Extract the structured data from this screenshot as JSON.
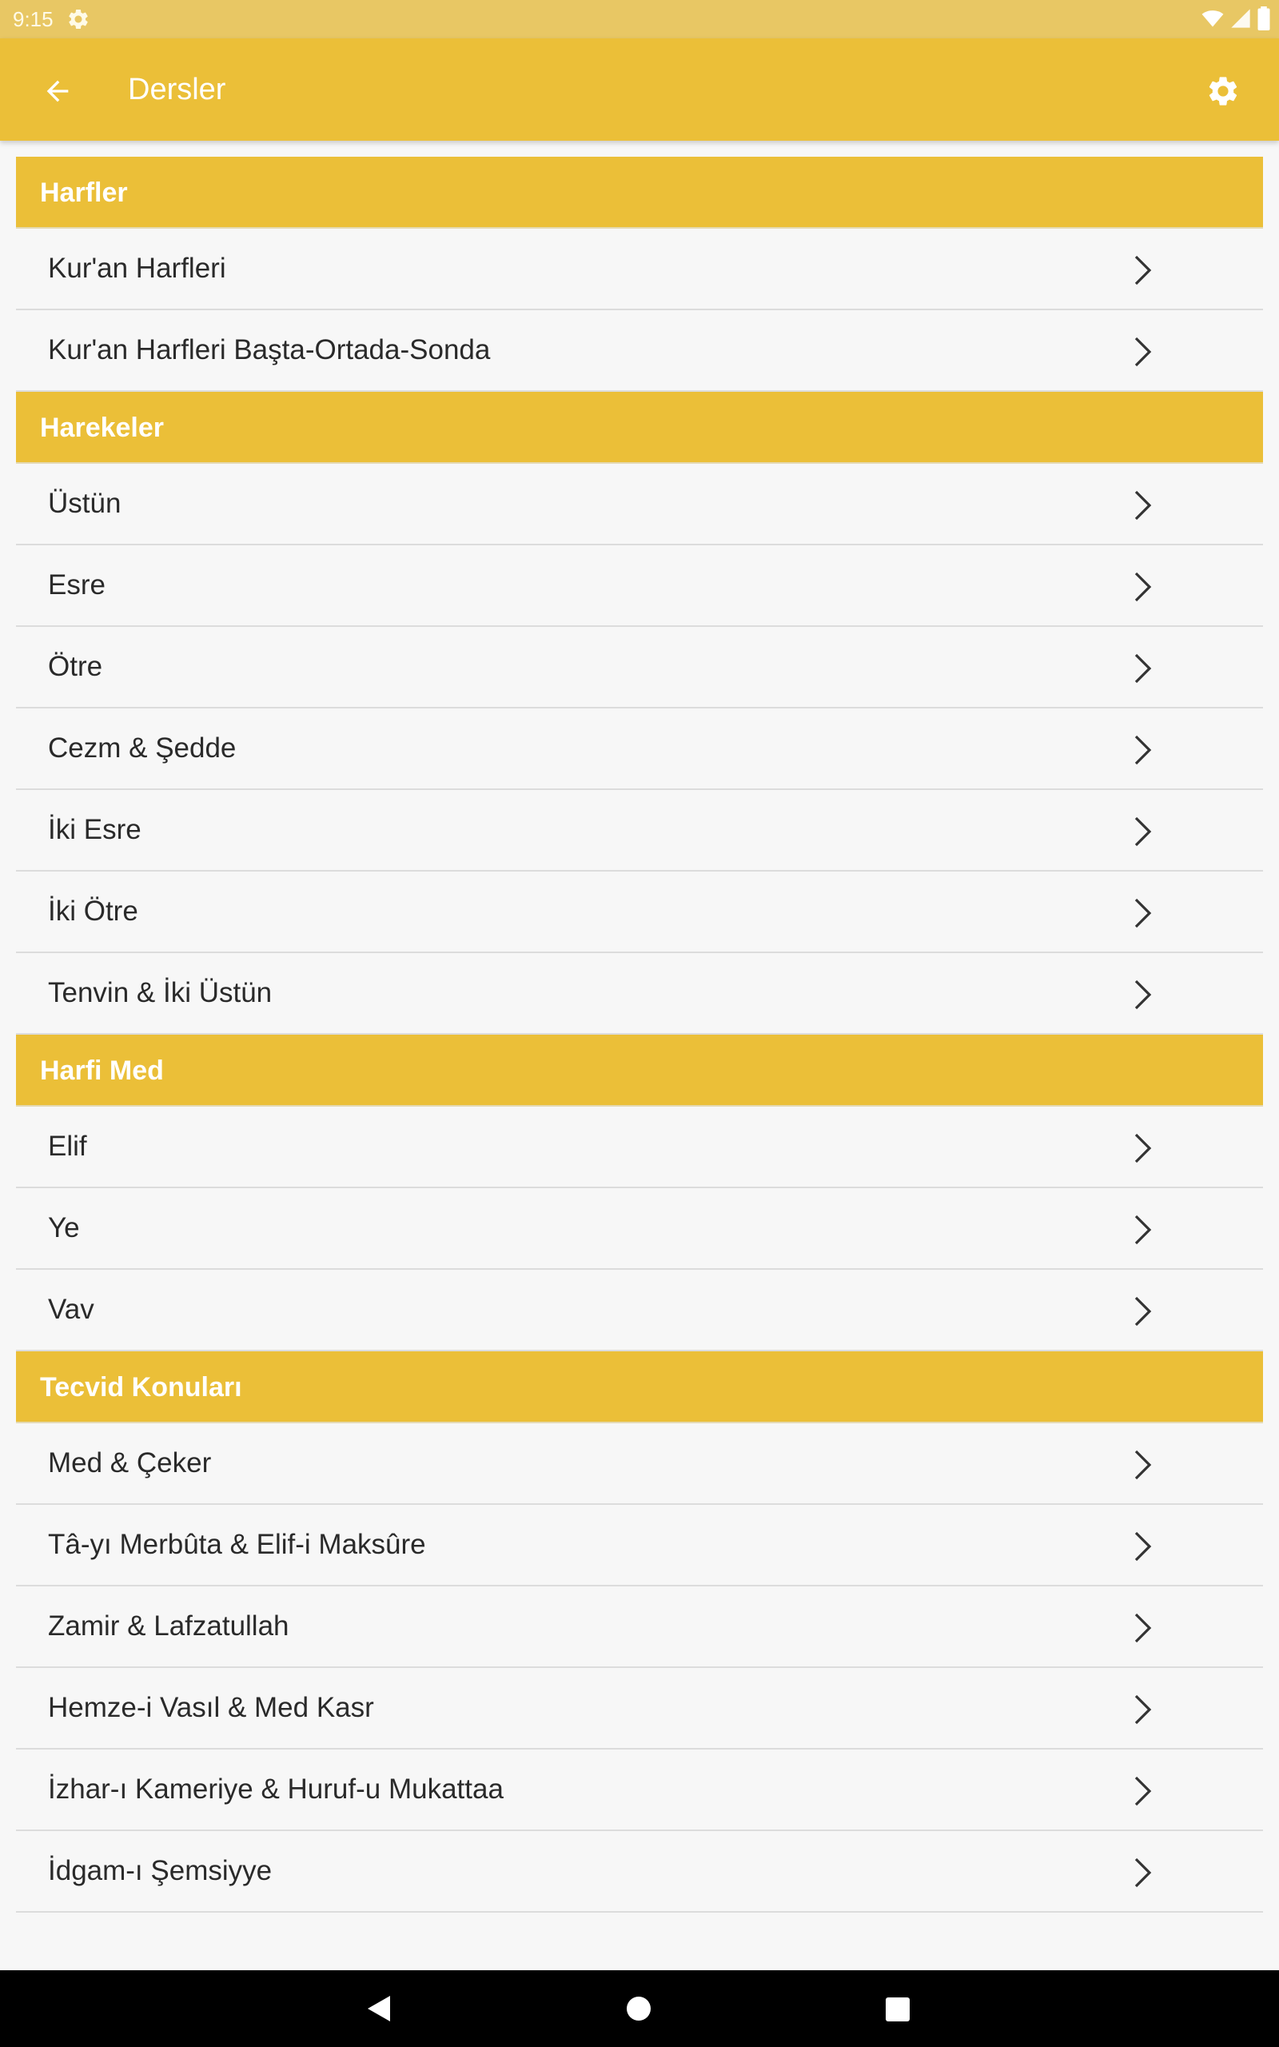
{
  "status_bar": {
    "time": "9:15",
    "icons": [
      "settings-icon",
      "wifi-icon",
      "cell-signal-icon",
      "battery-icon"
    ]
  },
  "app_bar": {
    "title": "Dersler",
    "back_icon": "arrow-left-icon",
    "settings_icon": "gear-icon",
    "color": "#ebbf38"
  },
  "sections": [
    {
      "header": "Harfler",
      "items": [
        "Kur'an Harfleri",
        "Kur'an Harfleri Başta-Ortada-Sonda"
      ]
    },
    {
      "header": "Harekeler",
      "items": [
        "Üstün",
        "Esre",
        "Ötre",
        "Cezm & Şedde",
        "İki Esre",
        "İki Ötre",
        "Tenvin & İki Üstün"
      ]
    },
    {
      "header": "Harfi Med",
      "items": [
        "Elif",
        "Ye",
        "Vav"
      ]
    },
    {
      "header": "Tecvid Konuları",
      "items": [
        "Med & Çeker",
        "Tâ-yı Merbûta & Elif-i Maksûre",
        "Zamir & Lafzatullah",
        "Hemze-i Vasıl & Med Kasr",
        "İzhar-ı Kameriye & Huruf-u Mukattaa",
        "İdgam-ı Şemsiyye"
      ]
    }
  ],
  "nav_bar": {
    "icons": [
      "nav-back-icon",
      "nav-home-icon",
      "nav-recents-icon"
    ]
  }
}
